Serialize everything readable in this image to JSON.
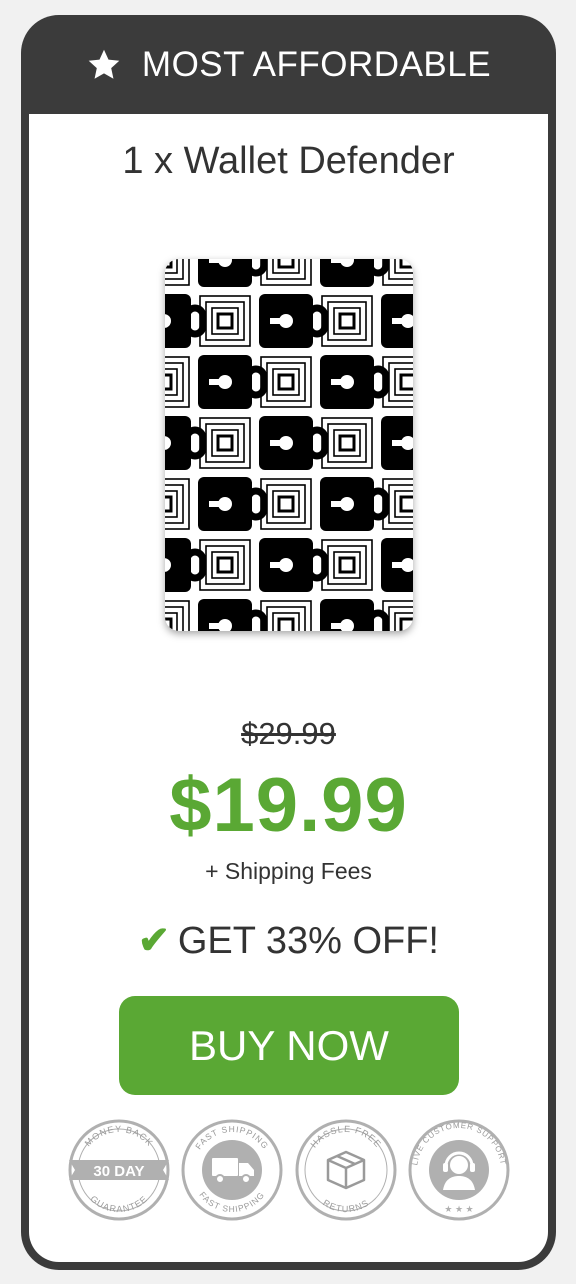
{
  "header": {
    "title": "MOST AFFORDABLE",
    "icon": "star-icon"
  },
  "product": {
    "title": "1 x Wallet Defender",
    "image": "wallet-defender-rfid-card",
    "old_price": "$29.99",
    "price": "$19.99",
    "shipping_note": "+ Shipping Fees",
    "discount_check": "✔",
    "discount_text": "GET 33% OFF!"
  },
  "buy_button": {
    "label": "BUY NOW"
  },
  "badges": [
    {
      "top": "MONEY BACK",
      "middle": "30 DAY",
      "bottom": "GUARANTEE"
    },
    {
      "top": "FAST SHIPPING",
      "bottom": "FAST SHIPPING",
      "icon": "truck-icon"
    },
    {
      "top": "HASSLE FREE",
      "bottom": "RETURNS",
      "icon": "box-icon"
    },
    {
      "top": "LIVE CUSTOMER SUPPORT",
      "icon": "headset-icon"
    }
  ],
  "colors": {
    "frame": "#3b3b3b",
    "accent": "#5aa834",
    "text": "#333333",
    "badge": "#b0b0b0"
  }
}
